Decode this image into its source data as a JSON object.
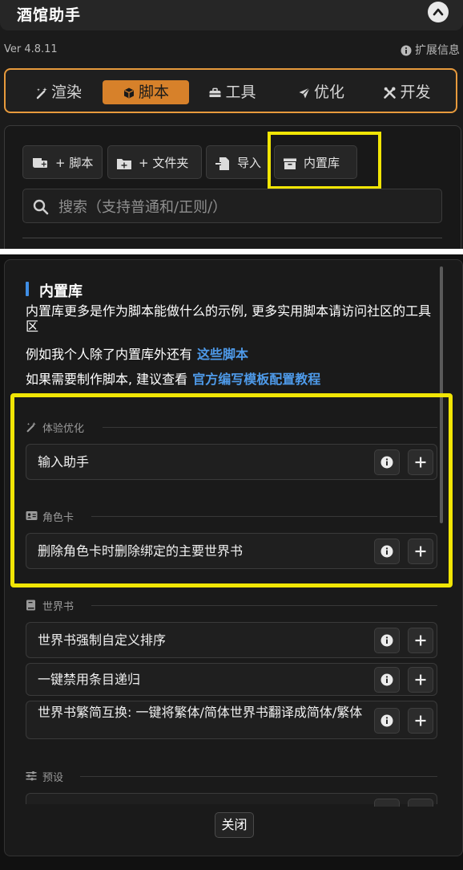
{
  "app": {
    "title": "酒馆助手",
    "version": "Ver 4.8.11",
    "ext_info": "扩展信息"
  },
  "tabs": [
    {
      "label": "渲染",
      "icon": "magic-wand-icon",
      "active": false
    },
    {
      "label": "脚本",
      "icon": "cube-icon",
      "active": true
    },
    {
      "label": "工具",
      "icon": "toolbox-icon",
      "active": false
    },
    {
      "label": "优化",
      "icon": "send-icon",
      "active": false
    },
    {
      "label": "开发",
      "icon": "tools-icon",
      "active": false
    }
  ],
  "toolbar": {
    "add_script": "+ 脚本",
    "add_folder": "+ 文件夹",
    "import": "导入",
    "builtin": "内置库"
  },
  "search": {
    "placeholder": "搜索（支持普通和/正则/）"
  },
  "modal": {
    "title": "内置库",
    "desc": "内置库更多是作为脚本能做什么的示例, 更多实用脚本请访问社区的工具区",
    "line1_text": "例如我个人除了内置库外还有",
    "line1_link": "这些脚本",
    "line2_text": "如果需要制作脚本, 建议查看",
    "line2_link": "官方编写模板配置教程",
    "sections": [
      {
        "title": "体验优化",
        "icon": "magic-wand-icon",
        "items": [
          "输入助手"
        ]
      },
      {
        "title": "角色卡",
        "icon": "id-card-icon",
        "items": [
          "删除角色卡时删除绑定的主要世界书"
        ]
      },
      {
        "title": "世界书",
        "icon": "book-icon",
        "items": [
          "世界书强制自定义排序",
          "一键禁用条目递归",
          "世界书繁简互换: 一键将繁体/简体世界书翻译成简体/繁体"
        ]
      },
      {
        "title": "预设",
        "icon": "sliders-icon",
        "items": []
      }
    ],
    "close_label": "关闭"
  },
  "colors": {
    "accent_orange": "#d7812a",
    "tab_border": "#e79a3c",
    "highlight_yellow": "#f1e505",
    "link_blue": "#4e9ae9",
    "title_bar_blue": "#3f8ee5"
  }
}
